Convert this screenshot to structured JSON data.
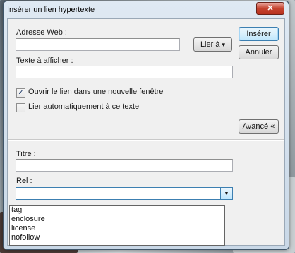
{
  "dialog": {
    "title": "Insérer un lien hypertexte",
    "close_label": "✕"
  },
  "form": {
    "url_label": "Adresse Web :",
    "url_value": "",
    "link_to_label": "Lier à",
    "link_to_arrow": "▾",
    "text_label": "Texte à afficher :",
    "text_value": "",
    "open_new_window_label": "Ouvrir le lien dans une nouvelle fenêtre",
    "open_new_window_checked": true,
    "auto_link_label": "Lier automatiquement à ce texte",
    "auto_link_checked": false,
    "advanced_label": "Avancé «",
    "title_label": "Titre :",
    "title_value": "",
    "rel_label": "Rel :",
    "rel_value": ""
  },
  "buttons": {
    "insert": "Insérer",
    "cancel": "Annuler"
  },
  "rel_options": [
    "tag",
    "enclosure",
    "license",
    "nofollow"
  ],
  "icons": {
    "check": "✓",
    "dropdown": "▼"
  },
  "colors": {
    "close_button": "#c5432f",
    "default_button_border": "#3c7fb1"
  }
}
